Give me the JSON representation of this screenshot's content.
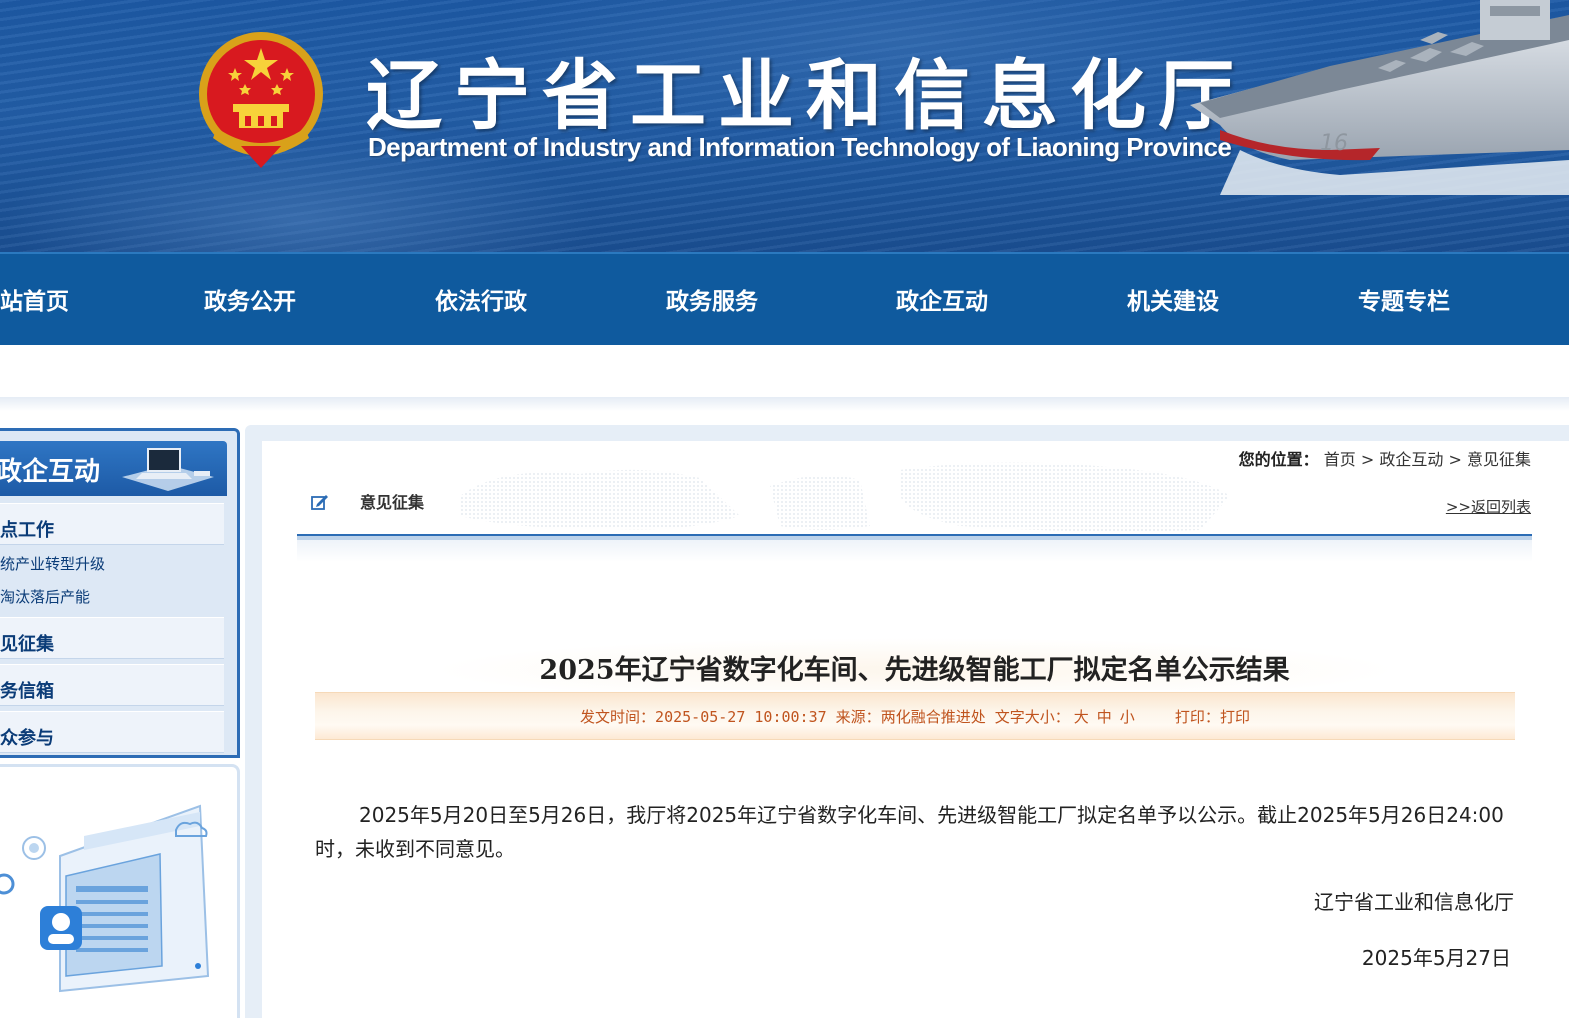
{
  "header": {
    "title_cn": "辽宁省工业和信息化厅",
    "title_en": "Department of Industry and Information Technology of Liaoning Province"
  },
  "nav": {
    "items": [
      {
        "label": "站首页"
      },
      {
        "label": "政务公开"
      },
      {
        "label": "依法行政"
      },
      {
        "label": "政务服务"
      },
      {
        "label": "政企互动"
      },
      {
        "label": "机关建设"
      },
      {
        "label": "专题专栏"
      }
    ]
  },
  "sidebar": {
    "title": "政企互动",
    "items": [
      {
        "label": "点工作",
        "level": 1
      },
      {
        "label": "统产业转型升级",
        "level": 2
      },
      {
        "label": "淘汰落后产能",
        "level": 2
      },
      {
        "label": "见征集",
        "level": 1
      },
      {
        "label": "务信箱",
        "level": 1
      },
      {
        "label": "众参与",
        "level": 1
      }
    ]
  },
  "breadcrumb": {
    "label": "您的位置：",
    "items": [
      "首页",
      "政企互动",
      "意见征集"
    ],
    "separator": " > "
  },
  "section": {
    "title": "意见征集",
    "back_link": ">>返回列表"
  },
  "article": {
    "title": "2025年辽宁省数字化车间、先进级智能工厂拟定名单公示结果",
    "meta": {
      "date_label": "发文时间：",
      "date": "2025-05-27 10:00:37",
      "source_label": "来源：",
      "source": "两化融合推进处",
      "font_size_label": "文字大小：",
      "size_large": "大",
      "size_medium": "中",
      "size_small": "小",
      "print_label": "打印：",
      "print_link": "打印"
    },
    "body": "2025年5月20日至5月26日，我厅将2025年辽宁省数字化车间、先进级智能工厂拟定名单予以公示。截止2025年5月26日24:00时，未收到不同意见。",
    "signature_org": "辽宁省工业和信息化厅",
    "signature_date": "2025年5月27日"
  },
  "colors": {
    "nav_bg": "#0f5a9e",
    "banner_blue": "#225ea8",
    "meta_text": "#c0541e",
    "sidebar_text": "#0b3c78"
  }
}
